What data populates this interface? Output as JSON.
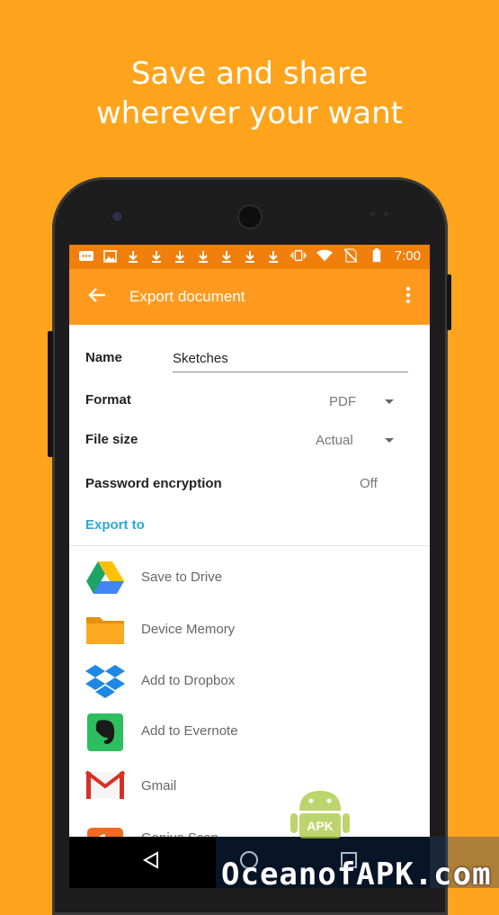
{
  "promo": {
    "line1": "Save and share",
    "line2": "wherever your want"
  },
  "status_bar": {
    "time": "7:00",
    "icons": [
      "message-icon",
      "image-icon",
      "download-icon",
      "download-icon",
      "download-icon",
      "download-icon",
      "download-icon",
      "download-icon",
      "download-icon",
      "vibrate-icon",
      "wifi-icon",
      "no-sim-icon",
      "battery-icon"
    ]
  },
  "toolbar": {
    "title": "Export document",
    "back_icon": "arrow-back-icon",
    "menu_icon": "more-vert-icon"
  },
  "form": {
    "name_label": "Name",
    "name_value": "Sketches",
    "format_label": "Format",
    "format_value": "PDF",
    "file_size_label": "File size",
    "file_size_value": "Actual",
    "password_label": "Password encryption",
    "password_value": "Off"
  },
  "export_to": {
    "header": "Export to",
    "items": [
      {
        "label": "Save to Drive",
        "icon": "google-drive-icon"
      },
      {
        "label": "Device Memory",
        "icon": "folder-icon"
      },
      {
        "label": "Add to Dropbox",
        "icon": "dropbox-icon"
      },
      {
        "label": "Add to Evernote",
        "icon": "evernote-icon"
      },
      {
        "label": "Gmail",
        "icon": "gmail-icon"
      },
      {
        "label": "Genius Scan",
        "icon": "genius-scan-icon"
      }
    ]
  },
  "nav_bar": {
    "icons": [
      "nav-back-icon",
      "nav-home-icon",
      "nav-recents-icon"
    ]
  },
  "watermark": {
    "text": "OceanofAPK.com",
    "badge": "APK"
  },
  "colors": {
    "background": "#FFA41C",
    "status_bar": "#F07F0B",
    "toolbar": "#FF9A1F",
    "accent_blue": "#29A7DF"
  }
}
